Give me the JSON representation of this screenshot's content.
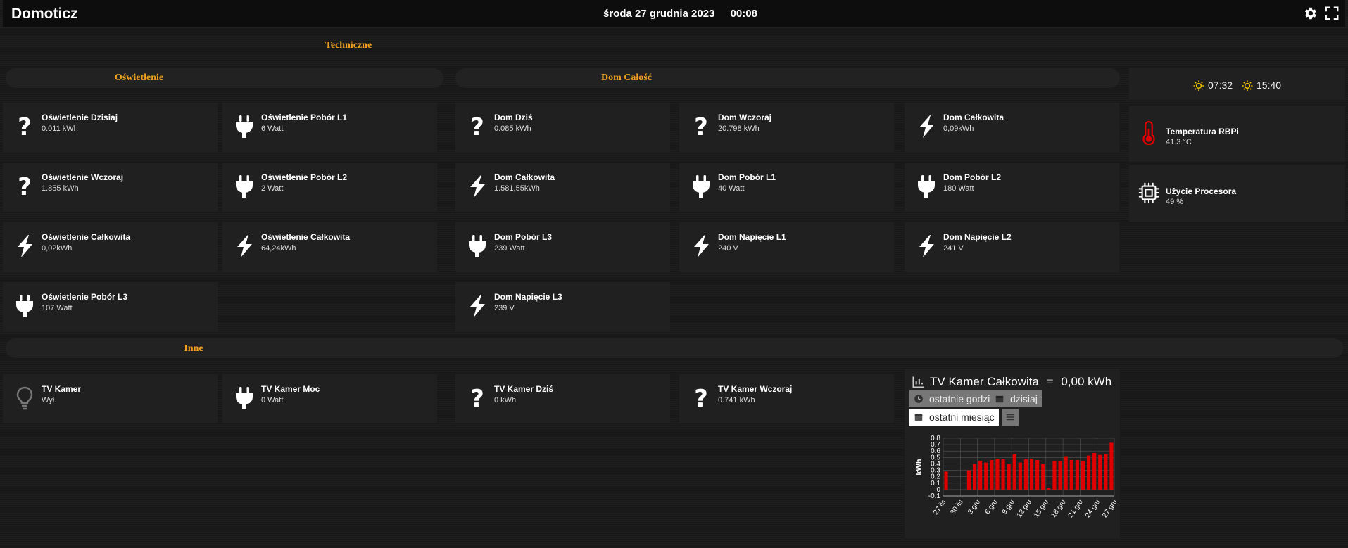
{
  "header": {
    "brand": "Domoticz",
    "date": "środa 27 grudnia 2023",
    "time": "00:08"
  },
  "sections": {
    "techniczne": "Techniczne",
    "oswietlenie": "Oświetlenie",
    "dom": "Dom Całość",
    "inne": "Inne"
  },
  "sun": {
    "sunrise": "07:32",
    "sunset": "15:40"
  },
  "tiles": [
    {
      "name": "Oświetlenie Dzisiaj",
      "value": "0.011 kWh",
      "icon": "question-icon"
    },
    {
      "name": "Oświetlenie Pobór L1",
      "value": "6 Watt",
      "icon": "plug-icon"
    },
    {
      "name": "Oświetlenie Wczoraj",
      "value": "1.855 kWh",
      "icon": "question-icon"
    },
    {
      "name": "Oświetlenie Pobór L2",
      "value": "2 Watt",
      "icon": "plug-icon"
    },
    {
      "name": "Oświetlenie Całkowita",
      "value": "0,02kWh",
      "icon": "bolt-icon"
    },
    {
      "name": "Oświetlenie Całkowita",
      "value": "64,24kWh",
      "icon": "bolt-icon"
    },
    {
      "name": "Oświetlenie Pobór L3",
      "value": "107 Watt",
      "icon": "plug-icon"
    },
    {
      "name": "Dom Dziś",
      "value": "0.085 kWh",
      "icon": "question-icon"
    },
    {
      "name": "Dom Wczoraj",
      "value": "20.798 kWh",
      "icon": "question-icon"
    },
    {
      "name": "Dom Całkowita",
      "value": "0,09kWh",
      "icon": "bolt-icon"
    },
    {
      "name": "Dom Całkowita",
      "value": "1.581,55kWh",
      "icon": "bolt-icon"
    },
    {
      "name": "Dom Pobór L1",
      "value": "40 Watt",
      "icon": "plug-icon"
    },
    {
      "name": "Dom Pobór L2",
      "value": "180 Watt",
      "icon": "plug-icon"
    },
    {
      "name": "Dom Pobór L3",
      "value": "239 Watt",
      "icon": "plug-icon"
    },
    {
      "name": "Dom Napięcie L1",
      "value": "240 V",
      "icon": "bolt-icon"
    },
    {
      "name": "Dom Napięcie L2",
      "value": "241 V",
      "icon": "bolt-icon"
    },
    {
      "name": "Dom Napięcie L3",
      "value": "239 V",
      "icon": "bolt-icon"
    },
    {
      "name": "TV Kamer",
      "value": "Wył.",
      "icon": "bulb-icon"
    },
    {
      "name": "TV Kamer Moc",
      "value": "0 Watt",
      "icon": "plug-icon"
    },
    {
      "name": "TV Kamer Dziś",
      "value": "0 kWh",
      "icon": "question-icon"
    },
    {
      "name": "TV Kamer Wczoraj",
      "value": "0.741 kWh",
      "icon": "question-icon"
    }
  ],
  "right_tiles": [
    {
      "name": "Temperatura RBPi",
      "value": "41.3 °C",
      "icon": "thermometer-icon",
      "color": "#e00000"
    },
    {
      "name": "Użycie Procesora",
      "value": "49 %",
      "icon": "cpu-icon"
    }
  ],
  "graph": {
    "title": "TV Kamer Całkowita",
    "value": "0,00 kWh",
    "buttons": [
      "ostatnie godziny",
      "dzisiaj",
      "ostatni miesiąc"
    ],
    "active_button": "ostatni miesiąc"
  },
  "chart_data": {
    "type": "bar",
    "ylabel": "kWh",
    "ylim": [
      -0.1,
      0.8
    ],
    "yticks": [
      "0.8",
      "0.7",
      "0.6",
      "0.5",
      "0.4",
      "0.3",
      "0.2",
      "0.1",
      "0",
      "-0.1"
    ],
    "xticks": [
      "27 lis",
      "30 lis",
      "3 gru",
      "6 gru",
      "9 gru",
      "12 gru",
      "15 gru",
      "18 gru",
      "21 gru",
      "24 gru",
      "27 gru"
    ],
    "values": [
      0.28,
      0,
      0,
      0,
      0.3,
      0.4,
      0.45,
      0.42,
      0.46,
      0.48,
      0.47,
      0.4,
      0.55,
      0.42,
      0.47,
      0.48,
      0.46,
      0.4,
      0.02,
      0.44,
      0.44,
      0.52,
      0.46,
      0.46,
      0.44,
      0.53,
      0.57,
      0.54,
      0.55,
      0.73
    ],
    "bar_color": "#e00000"
  }
}
